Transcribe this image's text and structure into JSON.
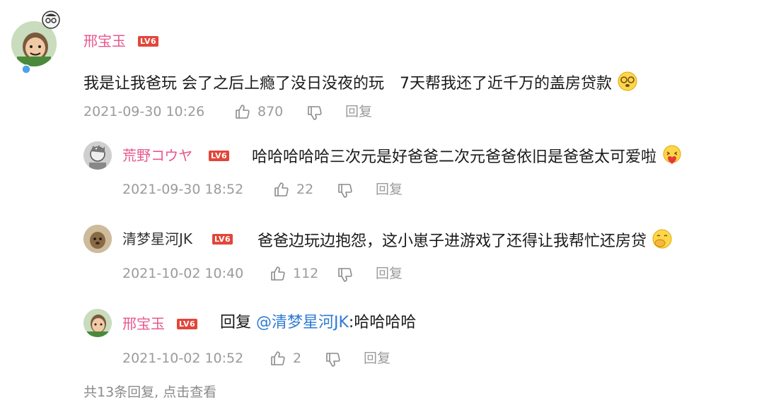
{
  "level_badge": "LV6",
  "main_comment": {
    "username": "邢宝玉",
    "text": "我是让我爸玩 会了之后上瘾了没日没夜的玩　7天帮我还了近千万的盖房贷款",
    "timestamp": "2021-09-30 10:26",
    "likes": "870",
    "reply_label": "回复",
    "emoji": "dizzy-face"
  },
  "replies": [
    {
      "username": "荒野コウヤ",
      "text": "哈哈哈哈哈三次元是好爸爸二次元爸爸依旧是爸爸太可爱啦",
      "timestamp": "2021-09-30 18:52",
      "likes": "22",
      "reply_label": "回复",
      "emoji": "heart-hug-face"
    },
    {
      "username": "清梦星河JK",
      "text": "爸爸边玩边抱怨，这小崽子进游戏了还得让我帮忙还房贷",
      "timestamp": "2021-10-02 10:40",
      "likes": "112",
      "reply_label": "回复",
      "emoji": "hand-over-mouth-face"
    },
    {
      "username": "邢宝玉",
      "reply_prefix": "回复 ",
      "mention": "@清梦星河JK",
      "text": ":哈哈哈哈",
      "timestamp": "2021-10-02 10:52",
      "likes": "2",
      "reply_label": "回复"
    }
  ],
  "footer": {
    "more_replies": "共13条回复, 点击查看"
  },
  "colors": {
    "username": "#e8588e",
    "level_badge": "#e2463a",
    "mention": "#2f7ad4",
    "meta": "#9b9b9b"
  }
}
